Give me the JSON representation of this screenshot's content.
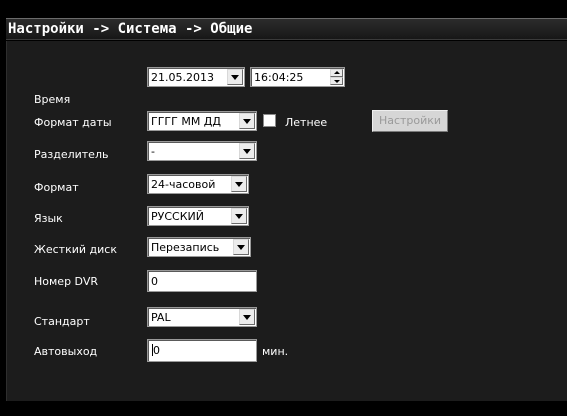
{
  "window": {
    "title": "Настройки -> Система -> Общие"
  },
  "form": {
    "time": {
      "label": "Время",
      "date_value": "21.05.2013",
      "time_value": "16:04:25"
    },
    "date_format": {
      "label": "Формат даты",
      "value": "ГГГГ ММ ДД",
      "dst_label": "Летнее",
      "dst_checked": false,
      "settings_button": "Настройки",
      "settings_button_enabled": false
    },
    "separator": {
      "label": "Разделитель",
      "value": "-"
    },
    "time_format": {
      "label": "Формат",
      "value": "24-часовой"
    },
    "language": {
      "label": "Язык",
      "value": "РУССКИЙ"
    },
    "hard_disk": {
      "label": "Жесткий диск",
      "value": "Перезапись"
    },
    "dvr_number": {
      "label": "Номер DVR",
      "value": "0"
    },
    "standard": {
      "label": "Стандарт",
      "value": "PAL"
    },
    "auto_logout": {
      "label": "Автовыход",
      "value": "0",
      "unit": "мин."
    }
  },
  "icons": [
    "dropdown-arrow-icon",
    "spin-up-icon",
    "spin-down-icon",
    "checkbox-icon"
  ],
  "colors": {
    "panel_bg": "#1c1c1c",
    "window_bg": "#000000",
    "label_text": "#ffffff",
    "field_bg": "#ffffff",
    "disabled_button_text": "#9a9a9a"
  }
}
